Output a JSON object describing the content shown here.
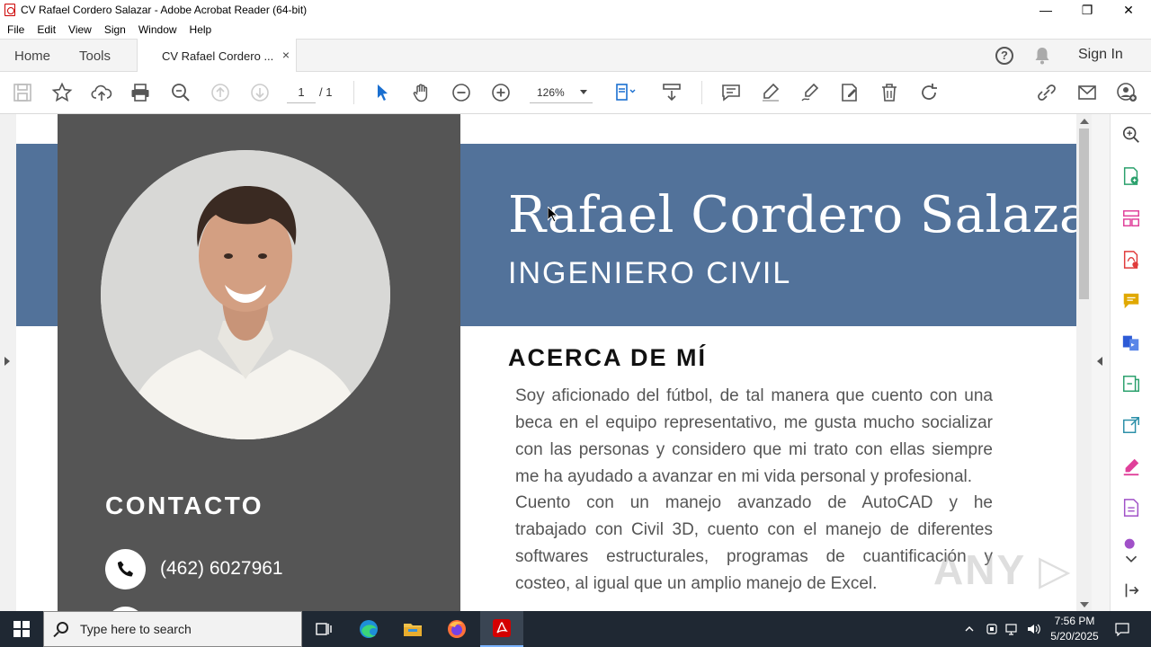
{
  "window": {
    "title": "CV Rafael Cordero Salazar - Adobe Acrobat Reader (64-bit)",
    "minimize": "—",
    "maximize": "❐",
    "close": "✕"
  },
  "menu": [
    "File",
    "Edit",
    "View",
    "Sign",
    "Window",
    "Help"
  ],
  "tabs": {
    "home": "Home",
    "tools": "Tools",
    "document": "CV Rafael Cordero ...",
    "close": "×",
    "sign_in": "Sign In",
    "help": "?"
  },
  "toolbar": {
    "page_current": "1",
    "page_total": "/ 1",
    "zoom": "126%"
  },
  "cv": {
    "name": "Rafael Cordero Salazar",
    "role": "INGENIERO CIVIL",
    "about_heading": "ACERCA DE MÍ",
    "about_lines": [
      "Soy aficionado del fútbol, de tal manera que cuento con una",
      "beca en el equipo representativo, me gusta mucho socializar",
      "con las personas y considero que mi trato con ellas siempre",
      "me ha ayudado a avanzar en mi vida personal y profesional.",
      "Cuento con un manejo avanzado de AutoCAD y he",
      "trabajado con Civil 3D, cuento con el manejo de diferentes",
      "softwares estructurales, programas de cuantificación y",
      "costeo, al igual que un amplio manejo de Excel."
    ],
    "contact_heading": "CONTACTO",
    "phone": "(462) 6027961"
  },
  "watermark": "ANY ▷ RUN",
  "taskbar": {
    "search_placeholder": "Type here to search",
    "time": "7:56 PM",
    "date": "5/20/2025"
  },
  "colors": {
    "banner_blue": "#52729a",
    "sidebar_gray": "#555555",
    "acrobat_red": "#cc0000",
    "rail_accents": [
      "#2d7ad6",
      "#e0409a",
      "#e0a800",
      "#2aa06c",
      "#a050c8"
    ]
  }
}
